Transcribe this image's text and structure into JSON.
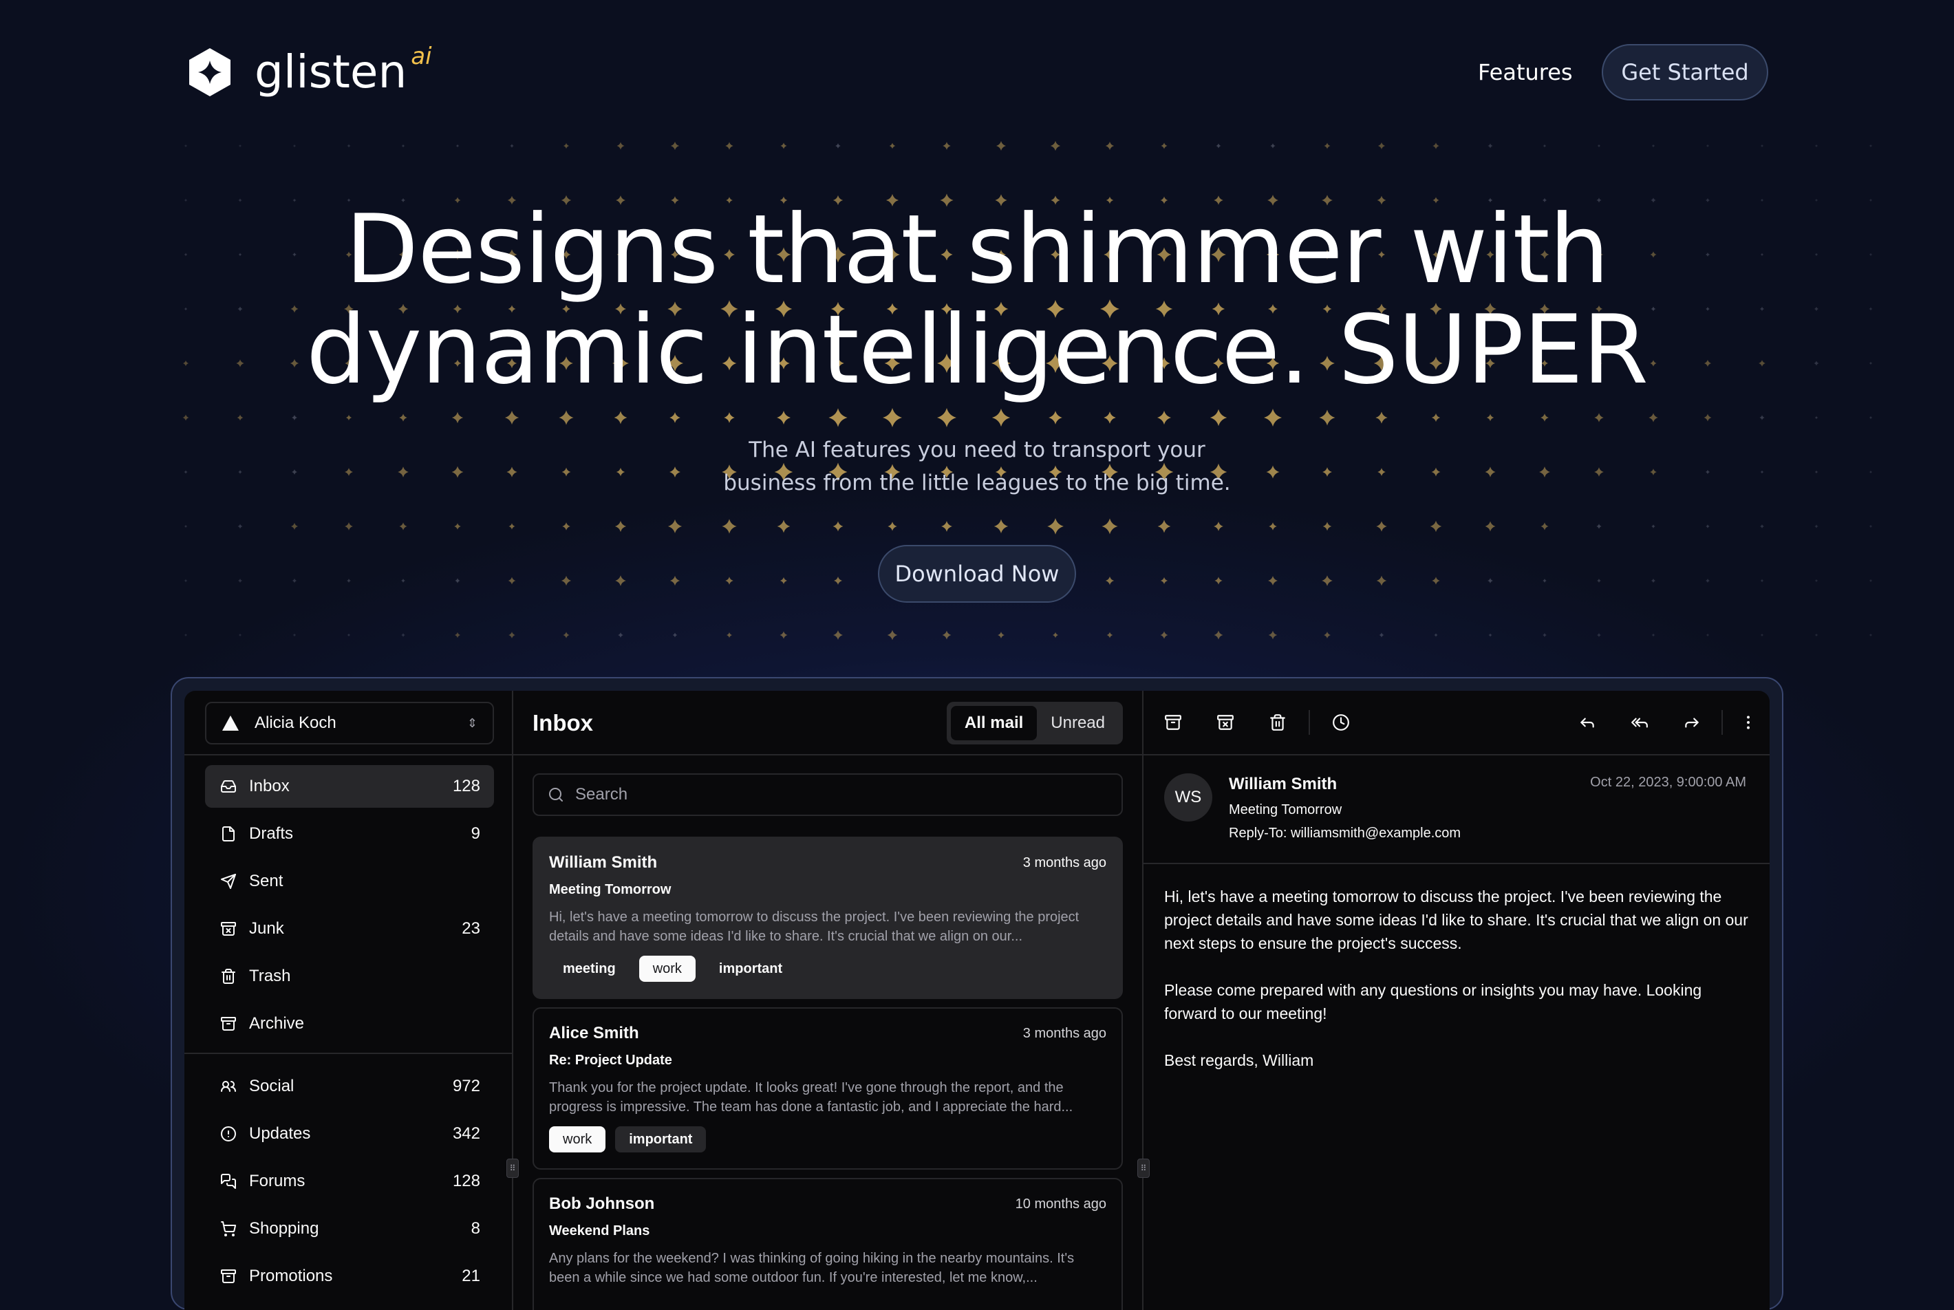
{
  "brand": {
    "name": "glisten",
    "suffix": "ai"
  },
  "nav": {
    "features": "Features",
    "cta": "Get Started"
  },
  "hero": {
    "title_line1": "Designs that shimmer with",
    "title_line2": "dynamic intelligence. SUPER",
    "subtitle_line1": "The AI features you need to transport your",
    "subtitle_line2": "business from the little leagues to the big time.",
    "cta": "Download Now"
  },
  "colors": {
    "background": "#0b0f1f",
    "star_gold": "#b99a55",
    "accent_gold": "#f3c14c",
    "app_bg": "#09090b"
  },
  "app": {
    "account": "Alicia Koch",
    "folders": [
      {
        "label": "Inbox",
        "count": "128",
        "icon": "inbox-icon"
      },
      {
        "label": "Drafts",
        "count": "9",
        "icon": "file-icon"
      },
      {
        "label": "Sent",
        "count": "",
        "icon": "send-icon"
      },
      {
        "label": "Junk",
        "count": "23",
        "icon": "archive-x-icon"
      },
      {
        "label": "Trash",
        "count": "",
        "icon": "trash-icon"
      },
      {
        "label": "Archive",
        "count": "",
        "icon": "archive-icon"
      }
    ],
    "categories": [
      {
        "label": "Social",
        "count": "972",
        "icon": "users-icon"
      },
      {
        "label": "Updates",
        "count": "342",
        "icon": "alert-circle-icon"
      },
      {
        "label": "Forums",
        "count": "128",
        "icon": "messages-icon"
      },
      {
        "label": "Shopping",
        "count": "8",
        "icon": "cart-icon"
      },
      {
        "label": "Promotions",
        "count": "21",
        "icon": "archive-icon"
      }
    ],
    "list": {
      "title": "Inbox",
      "tab_all": "All mail",
      "tab_unread": "Unread",
      "search_placeholder": "Search",
      "mails": [
        {
          "from": "William Smith",
          "when": "3 months ago",
          "subject": "Meeting Tomorrow",
          "body": "Hi, let's have a meeting tomorrow to discuss the project. I've been reviewing the project details and have some ideas I'd like to share. It's crucial that we align on our...",
          "tags": [
            "meeting",
            "work",
            "important"
          ]
        },
        {
          "from": "Alice Smith",
          "when": "3 months ago",
          "subject": "Re: Project Update",
          "body": "Thank you for the project update. It looks great! I've gone through the report, and the progress is impressive. The team has done a fantastic job, and I appreciate the hard...",
          "tags": [
            "work",
            "important"
          ]
        },
        {
          "from": "Bob Johnson",
          "when": "10 months ago",
          "subject": "Weekend Plans",
          "body": "Any plans for the weekend? I was thinking of going hiking in the nearby mountains. It's been a while since we had some outdoor fun. If you're interested, let me know,...",
          "tags": []
        }
      ]
    },
    "message": {
      "initials": "WS",
      "sender": "William Smith",
      "subject": "Meeting Tomorrow",
      "reply_to": "Reply-To: williamsmith@example.com",
      "date": "Oct 22, 2023, 9:00:00 AM",
      "para1": "Hi, let's have a meeting tomorrow to discuss the project. I've been reviewing the project details and have some ideas I'd like to share. It's crucial that we align on our next steps to ensure the project's success.",
      "para2": "Please come prepared with any questions or insights you may have. Looking forward to our meeting!",
      "para3": "Best regards, William"
    }
  }
}
